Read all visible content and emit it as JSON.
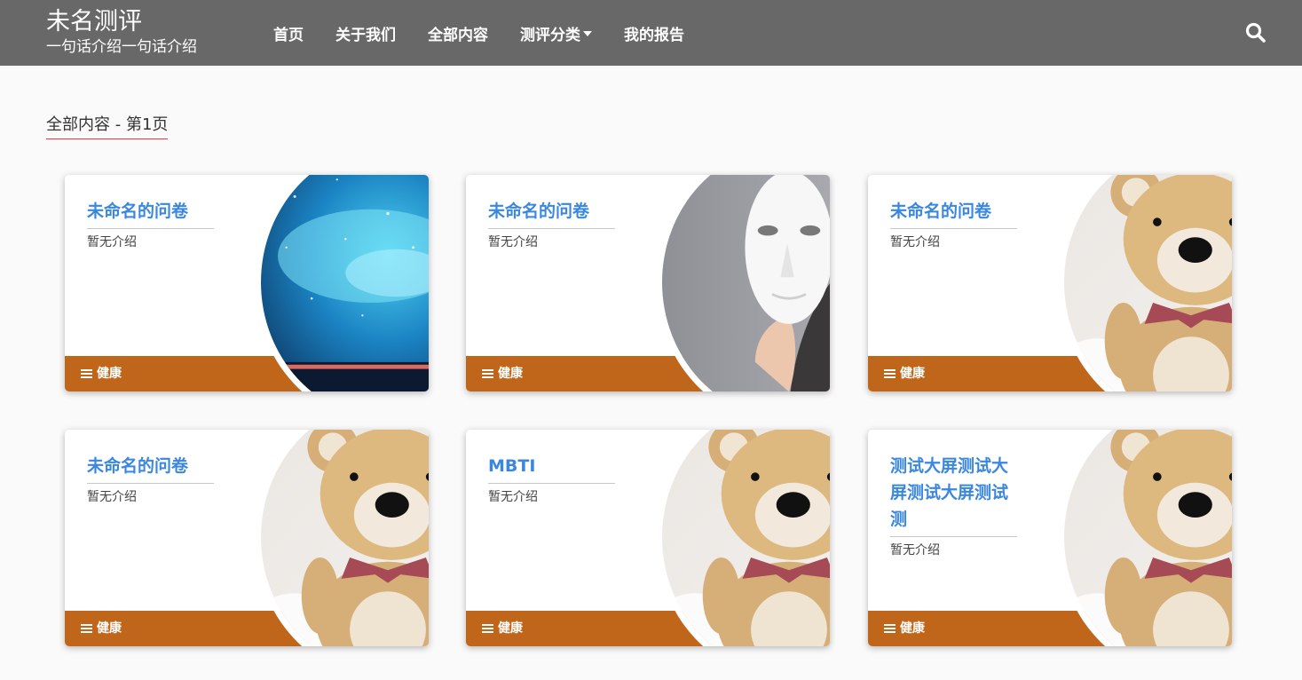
{
  "brand": {
    "title": "未名测评",
    "subtitle": "一句话介绍一句话介绍"
  },
  "nav": [
    {
      "label": "首页"
    },
    {
      "label": "关于我们"
    },
    {
      "label": "全部内容"
    },
    {
      "label": "测评分类",
      "has_dropdown": true
    },
    {
      "label": "我的报告"
    }
  ],
  "icons": {
    "search": "search-icon",
    "category": "menu-icon"
  },
  "page": {
    "heading": "全部内容 - 第1页"
  },
  "colors": {
    "topbar": "#686868",
    "footer": "#c0661a",
    "title": "#3a87e0",
    "heading_underline": "#e53945"
  },
  "cards": [
    {
      "title": "未命名的问卷",
      "desc": "暂无介绍",
      "tag": "健康",
      "image": "starry-sky"
    },
    {
      "title": "未命名的问卷",
      "desc": "暂无介绍",
      "tag": "健康",
      "image": "mask-person"
    },
    {
      "title": "未命名的问卷",
      "desc": "暂无介绍",
      "tag": "健康",
      "image": "teddy-bear"
    },
    {
      "title": "未命名的问卷",
      "desc": "暂无介绍",
      "tag": "健康",
      "image": "teddy-bear"
    },
    {
      "title": "MBTI",
      "desc": "暂无介绍",
      "tag": "健康",
      "image": "teddy-bear"
    },
    {
      "title": "测试大屏测试大屏测试大屏测试测",
      "desc": "暂无介绍",
      "tag": "健康",
      "image": "teddy-bear"
    }
  ]
}
